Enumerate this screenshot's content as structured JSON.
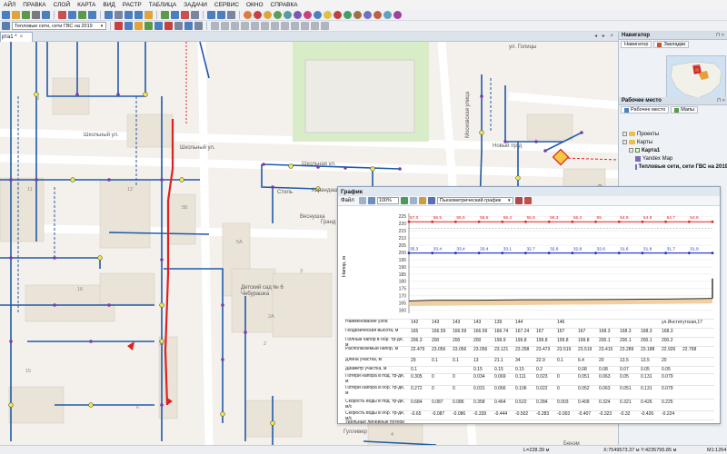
{
  "menu": [
    "АЙЛ",
    "ПРАВКА",
    "СЛОЙ",
    "КАРТА",
    "ВИД",
    "РАСТР",
    "ТАБЛИЦА",
    "ЗАДАЧИ",
    "СЕРВИС",
    "ОКНО",
    "СПРАВКА"
  ],
  "toolbar": {
    "layer_select": "Тепловые сети, сети ГВС на 2019"
  },
  "map_tab": {
    "label": "рта1 *",
    "close": "×",
    "nav": "◂ ▸ ×"
  },
  "map": {
    "labels": {
      "shkolny_1": "Школьный ул.",
      "shkolny_2": "Школьный ул.",
      "shkolnaya": "Школьная ул.",
      "moskovskaya": "Московская улица",
      "novy": "Новый пр-д",
      "golitsyn": "ул. Голицы",
      "stil": "Стиль",
      "karandash": "Карандаш",
      "vesnushka": "Веснушка",
      "grand_sm": "Гранд См",
      "detsky_sad": "Детский сад № 6 Чебурашка",
      "gulliver": "Гулливер",
      "benzin": "Бенэм"
    },
    "house_numbers": [
      "11",
      "12",
      "5Б",
      "5А",
      "3",
      "1",
      "16",
      "15",
      "2А",
      "2",
      "17",
      "6",
      "4",
      "13",
      "10",
      "9"
    ]
  },
  "navigator": {
    "title": "Навигатор",
    "tabs": [
      "Навигатор",
      "Закладки"
    ]
  },
  "workspace": {
    "title": "Рабочее место",
    "tabs": [
      "Рабочее место",
      "Мапы"
    ],
    "tree": [
      {
        "label": "Проекты",
        "level": 0
      },
      {
        "label": "Карты",
        "level": 0
      },
      {
        "label": "Карта1",
        "level": 1
      },
      {
        "label": "Yandex Map",
        "level": 2
      },
      {
        "label": "Тепловые сети, сети ГВС на 2019",
        "level": 2
      }
    ]
  },
  "graph": {
    "title": "График",
    "file_menu": "Файл",
    "zoom": "100%",
    "graph_type": "Пьезометрический график",
    "y_axis_label": "Напор, м",
    "row_labels": [
      "Наименование узла",
      "Геодезическая высота, м",
      "Полный напор в обр. тр-де, м",
      "Располагаемый напор, м",
      "Длина участка, м",
      "Диаметр участка, м",
      "Потери напора в под. тр-де, м",
      "Потери напора в обр. тр-де, м",
      "Скорость воды в под. тр-де, м/с",
      "Скорость воды в обр. тр-де, м/с",
      "Удельные линейные потери"
    ],
    "table": [
      [
        "142",
        "143",
        "143",
        "143",
        "139",
        "144",
        "",
        "146",
        "",
        "",
        "",
        "",
        "ул.Институтская,17"
      ],
      [
        "165",
        "166.59",
        "166.59",
        "166.59",
        "166.74",
        "167.24",
        "167",
        "167",
        "167",
        "168.3",
        "168.3",
        "168.3",
        "168.3"
      ],
      [
        "206.3",
        "200",
        "200",
        "200",
        "199.9",
        "199.8",
        "199.8",
        "199.8",
        "199.8",
        "200.1",
        "200.1",
        "200.1",
        "200.2"
      ],
      [
        "22.479",
        "23.056",
        "23.056",
        "23.056",
        "23.121",
        "23.258",
        "23.473",
        "23.519",
        "23.519",
        "23.415",
        "23.289",
        "23.188",
        "22.926",
        "22.768"
      ],
      [
        "29",
        "0.1",
        "0.1",
        "13",
        "21.1",
        "34",
        "22.9",
        "0.1",
        "6.4",
        "20",
        "13.5",
        "13.5",
        "20"
      ],
      [
        "0.1",
        "",
        "",
        "0.15",
        "0.15",
        "0.15",
        "0.2",
        "",
        "0.08",
        "0.08",
        "0.07",
        "0.05",
        "0.05"
      ],
      [
        "0.305",
        "0",
        "0",
        "0.034",
        "0.069",
        "0.111",
        "0.023",
        "0",
        "0.051",
        "0.063",
        "0.05",
        "0.131",
        "0.079"
      ],
      [
        "0.272",
        "0",
        "0",
        "0.031",
        "0.066",
        "0.106",
        "0.022",
        "0",
        "0.052",
        "0.063",
        "0.051",
        "0.131",
        "0.079"
      ],
      [
        "0.684",
        "0.087",
        "0.086",
        "0.358",
        "0.464",
        "0.522",
        "0.284",
        "0.003",
        "0.409",
        "0.324",
        "0.321",
        "0.426",
        "0.225"
      ],
      [
        "-0.65",
        "-0.087",
        "-0.086",
        "-0.339",
        "-0.444",
        "-0.502",
        "-0.283",
        "-0.003",
        "-0.407",
        "-0.323",
        "-0.32",
        "-0.426",
        "-0.224"
      ]
    ]
  },
  "chart_data": {
    "type": "line",
    "ylabel": "Напор, м",
    "ylim": [
      158,
      227
    ],
    "yticks": [
      160,
      165,
      170,
      175,
      180,
      185,
      190,
      195,
      200,
      205,
      210,
      215,
      220,
      225
    ],
    "series": [
      {
        "color": "#e02020",
        "values": [
          221.2,
          221.2,
          221.2,
          221.2,
          221.2,
          221.2,
          221.2,
          221.2,
          221.2,
          221.2,
          221.2,
          221.2,
          221.2,
          221.2
        ],
        "labels": [
          "57.0",
          "56.5",
          "56.5",
          "56.5",
          "56.4",
          "55.9",
          "56.3",
          "56.3",
          "55",
          "54.9",
          "54.9",
          "54.7",
          "54.6"
        ]
      },
      {
        "color": "#2030c0",
        "values": [
          199.6,
          199.6,
          199.6,
          199.6,
          199.6,
          199.6,
          199.6,
          199.6,
          199.6,
          199.6,
          199.6,
          199.6,
          199.6,
          199.6
        ],
        "labels": [
          "35.3",
          "33.4",
          "33.4",
          "33.4",
          "33.1",
          "32.7",
          "32.6",
          "32.8",
          "32.6",
          "31.6",
          "31.8",
          "31.7",
          "31.9"
        ]
      },
      {
        "color": "#3a3a3a",
        "values": [
          166.5,
          167,
          167,
          167,
          167.2,
          167.3,
          167.3,
          167.4,
          167.5,
          167.6,
          167.7,
          167.8,
          168,
          168.3
        ]
      }
    ],
    "grid": true
  },
  "statusbar": {
    "length": "L=228.39 м",
    "coords": "X:7549573.37 м  Y:4235795.85 м",
    "scale": "M1:1264"
  }
}
